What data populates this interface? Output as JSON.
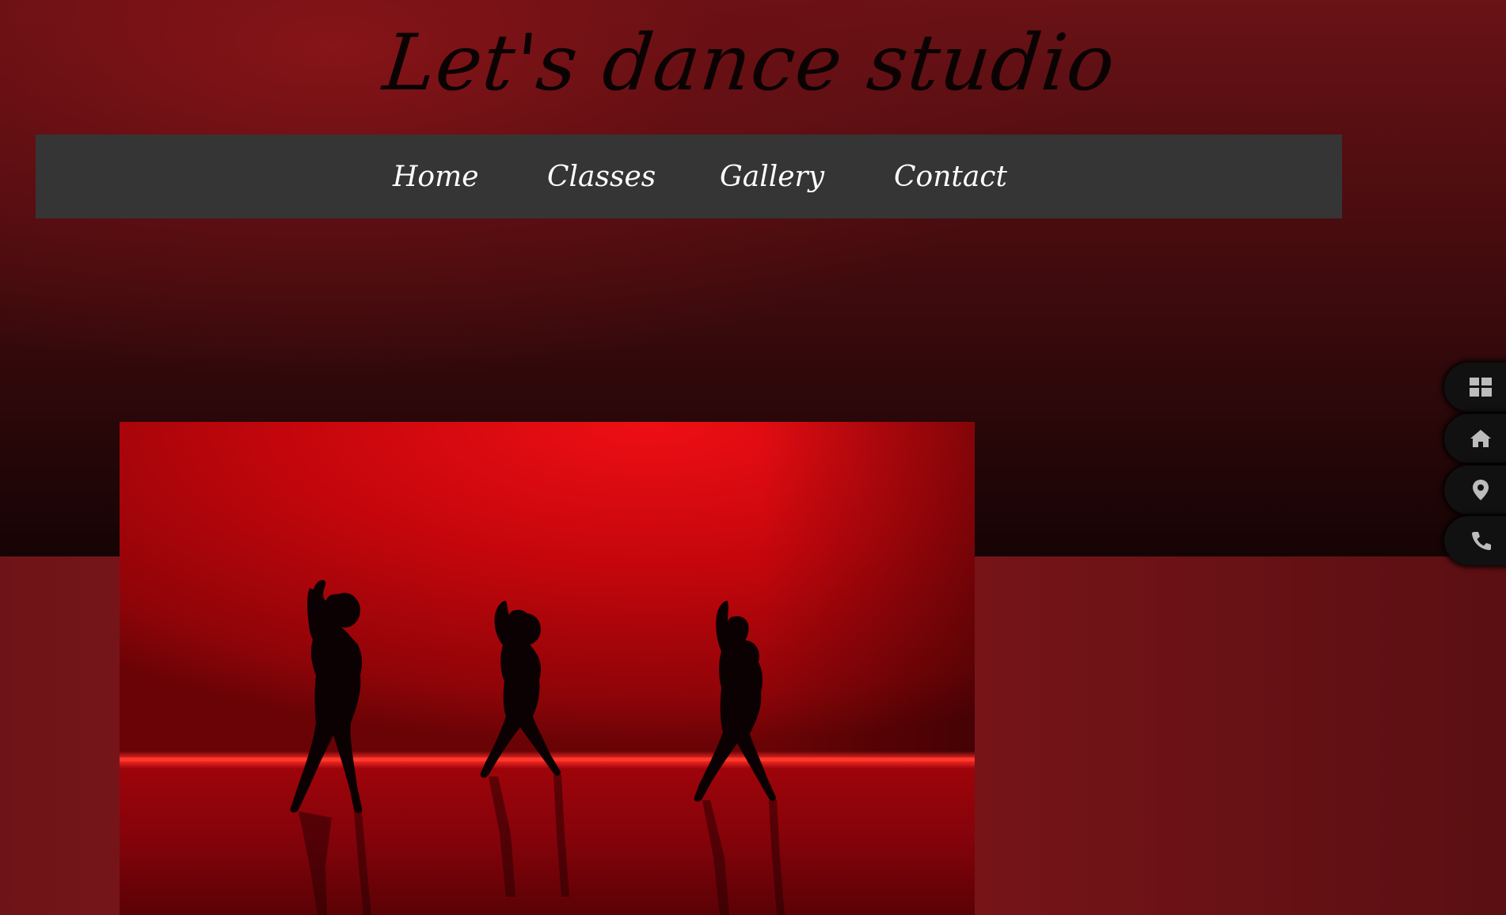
{
  "header": {
    "title": "Let's dance studio"
  },
  "nav": {
    "items": [
      {
        "label": "Home"
      },
      {
        "label": "Classes"
      },
      {
        "label": "Gallery"
      },
      {
        "label": "Contact"
      }
    ]
  },
  "side_rail": {
    "icons": [
      "grid-icon",
      "home-icon",
      "location-pin-icon",
      "phone-icon"
    ]
  },
  "colors": {
    "nav_background": "#353535",
    "nav_text": "#ffffff",
    "title_text": "#0b0303",
    "wall_red": "#6a1216",
    "stage_red": "#c4060c"
  }
}
